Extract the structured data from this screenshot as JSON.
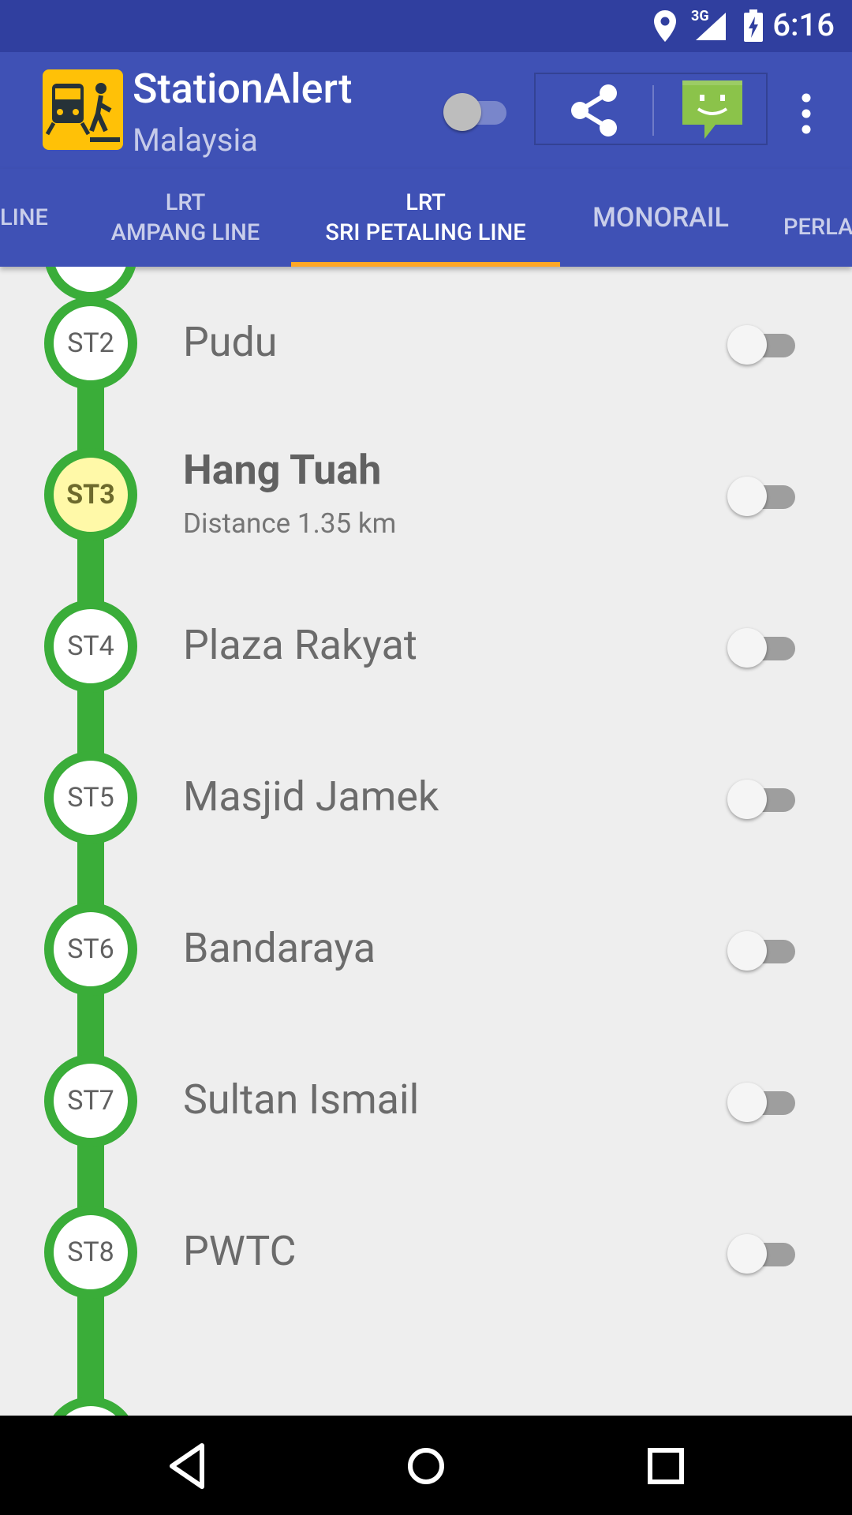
{
  "status_bar": {
    "network": "3G",
    "time": "6:16",
    "icons": [
      "location-icon",
      "signal-icon",
      "battery-charging-icon"
    ]
  },
  "app_bar": {
    "title": "StationAlert",
    "subtitle": "Malaysia",
    "master_toggle_on": false,
    "actions": [
      "share-icon",
      "chat-icon",
      "more-vert-icon"
    ]
  },
  "tabs": [
    {
      "line1": "",
      "line2": "LINE",
      "active": false
    },
    {
      "line1": "LRT",
      "line2": "AMPANG LINE",
      "active": false
    },
    {
      "line1": "LRT",
      "line2": "SRI PETALING LINE",
      "active": true
    },
    {
      "line1": "",
      "line2": "MONORAIL",
      "active": false
    },
    {
      "line1": "",
      "line2": "PERLA",
      "active": false
    }
  ],
  "line_color": "#3aad39",
  "stations": [
    {
      "code": "ST2",
      "name": "Pudu",
      "alert_on": false
    },
    {
      "code": "ST3",
      "name": "Hang Tuah",
      "distance": "Distance 1.35 km",
      "current": true,
      "alert_on": false
    },
    {
      "code": "ST4",
      "name": "Plaza Rakyat",
      "alert_on": false
    },
    {
      "code": "ST5",
      "name": "Masjid Jamek",
      "alert_on": false
    },
    {
      "code": "ST6",
      "name": "Bandaraya",
      "alert_on": false
    },
    {
      "code": "ST7",
      "name": "Sultan Ismail",
      "alert_on": false
    },
    {
      "code": "ST8",
      "name": "PWTC",
      "alert_on": false
    }
  ],
  "nav_bar": [
    "back-icon",
    "home-icon",
    "recents-icon"
  ]
}
